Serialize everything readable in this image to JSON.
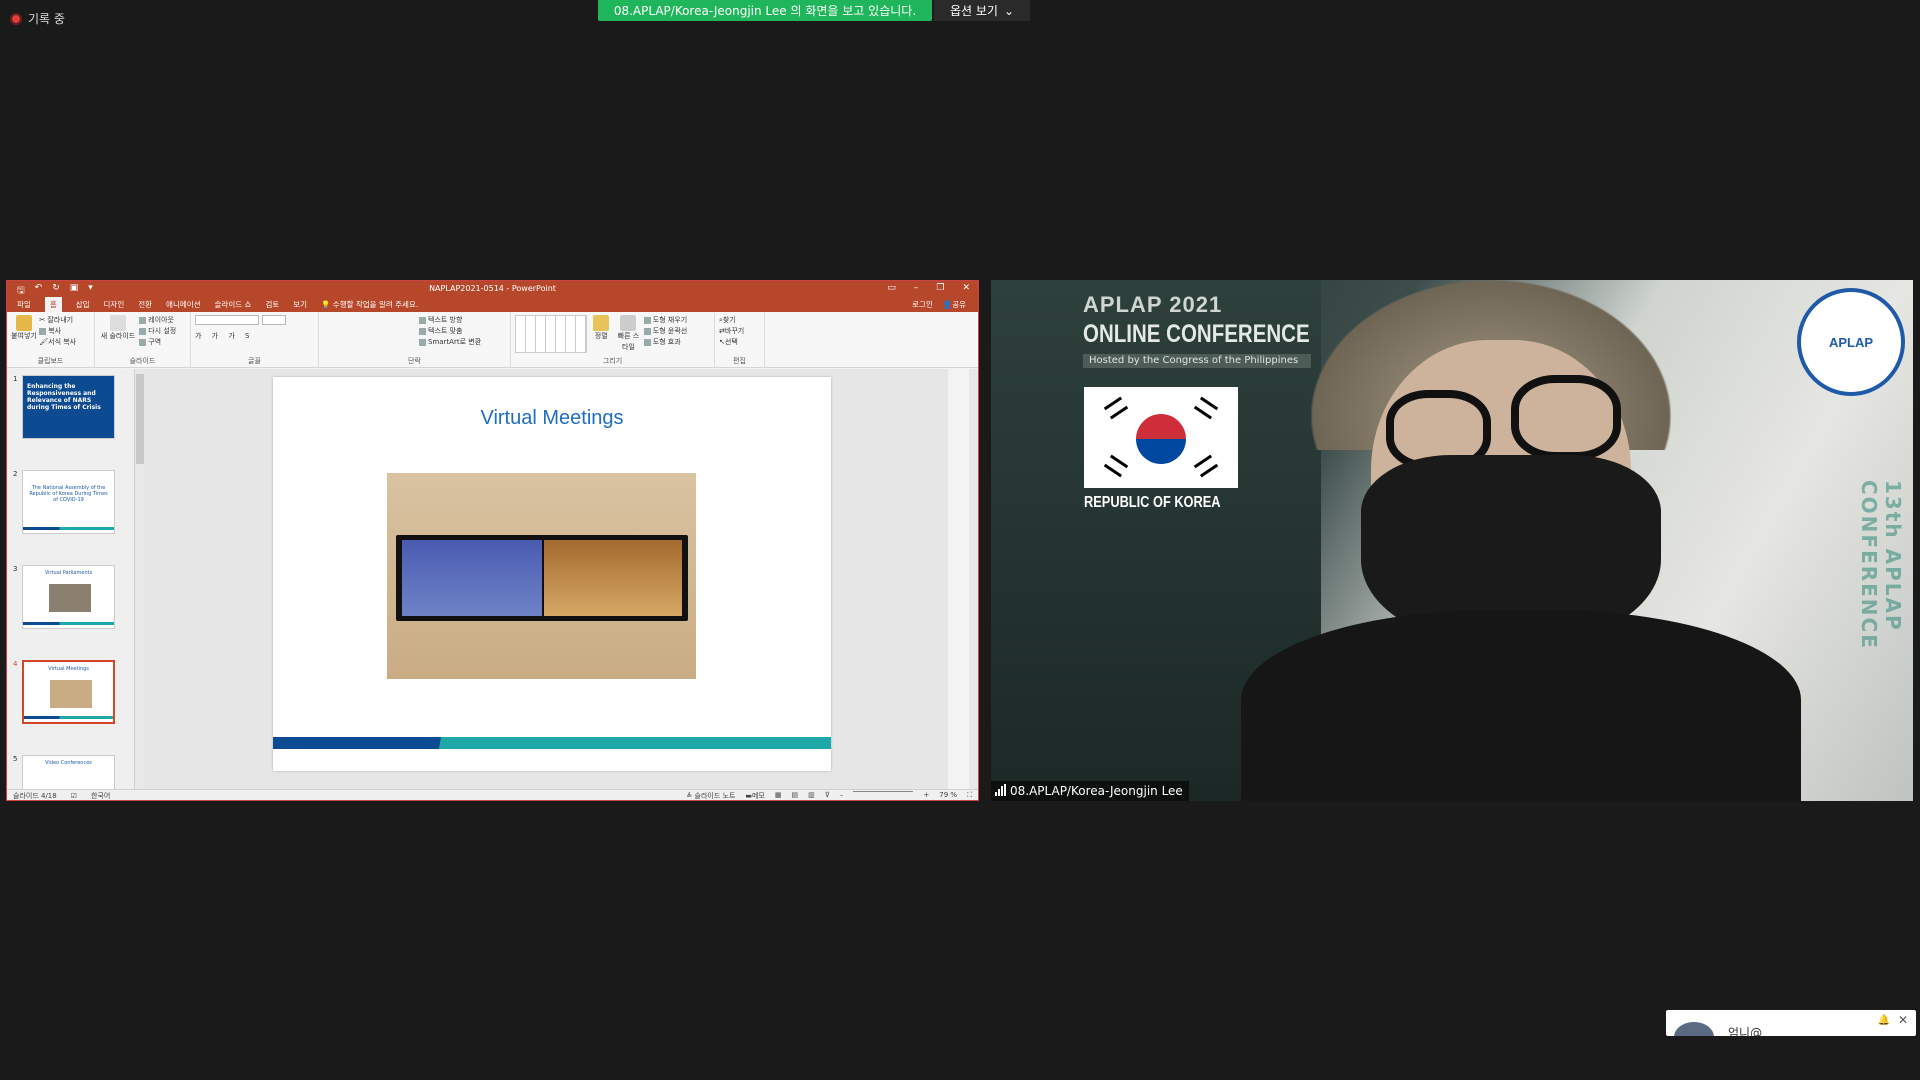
{
  "meeting": {
    "recording_label": "기록 중",
    "sharing_banner": "08.APLAP/Korea-Jeongjin  Lee 의 화면을 보고 있습니다.",
    "view_options": "옵션 보기"
  },
  "powerpoint": {
    "window_title": "NAPLAP2021-0514 - PowerPoint",
    "tabs": [
      "파일",
      "홈",
      "삽입",
      "디자인",
      "전환",
      "애니메이션",
      "슬라이드 쇼",
      "검토",
      "보기"
    ],
    "active_tab": "홈",
    "tell_me": "수행할 작업을 알려 주세요.",
    "login": "로그인",
    "share": "공유",
    "ribbon": {
      "clipboard": {
        "label": "클립보드",
        "paste": "붙여넣기",
        "cut": "잘라내기",
        "copy": "복사",
        "format": "서식 복사"
      },
      "slides": {
        "label": "슬라이드",
        "new": "새 슬라이드",
        "layout": "레이아웃",
        "reset": "다시 설정",
        "section": "구역"
      },
      "font": {
        "label": "글꼴"
      },
      "paragraph": {
        "label": "단락",
        "text_dir": "텍스트 방향",
        "align_text": "텍스트 맞춤",
        "smartart": "SmartArt로 변환"
      },
      "drawing": {
        "label": "그리기",
        "arrange": "정렬",
        "quick_styles": "빠른 스타일",
        "fill": "도형 채우기",
        "outline": "도형 윤곽선",
        "effects": "도형 효과"
      },
      "editing": {
        "label": "편집",
        "find": "찾기",
        "replace": "바꾸기",
        "select": "선택"
      }
    },
    "thumbnails": [
      {
        "num": "1",
        "text": "Enhancing the Responsiveness and Relevance of NARS during Times of Crisis"
      },
      {
        "num": "2",
        "text": "The National Assembly of the Republic of Korea During Times of COVID-19"
      },
      {
        "num": "3",
        "text": "Virtual Parliaments"
      },
      {
        "num": "4",
        "text": "Virtual Meetings"
      },
      {
        "num": "5",
        "text": "Video Conferences"
      }
    ],
    "slide": {
      "title": "Virtual Meetings"
    },
    "status": {
      "slide_count": "슬라이드 4/18",
      "language": "한국어",
      "notes": "슬라이드 노트",
      "comments": "메모",
      "zoom": "79 %"
    }
  },
  "video": {
    "conf_line1": "APLAP 2021",
    "conf_line2": "ONLINE CONFERENCE",
    "hosted": "Hosted by the Congress of the Philippines",
    "country": "REPUBLIC OF KOREA",
    "side_text": "13th APLAP CONFERENCE",
    "logo_text": "APLAP",
    "participant_name": "08.APLAP/Korea-Jeongjin Lee"
  },
  "chat_popup": {
    "name": "엄니@"
  }
}
